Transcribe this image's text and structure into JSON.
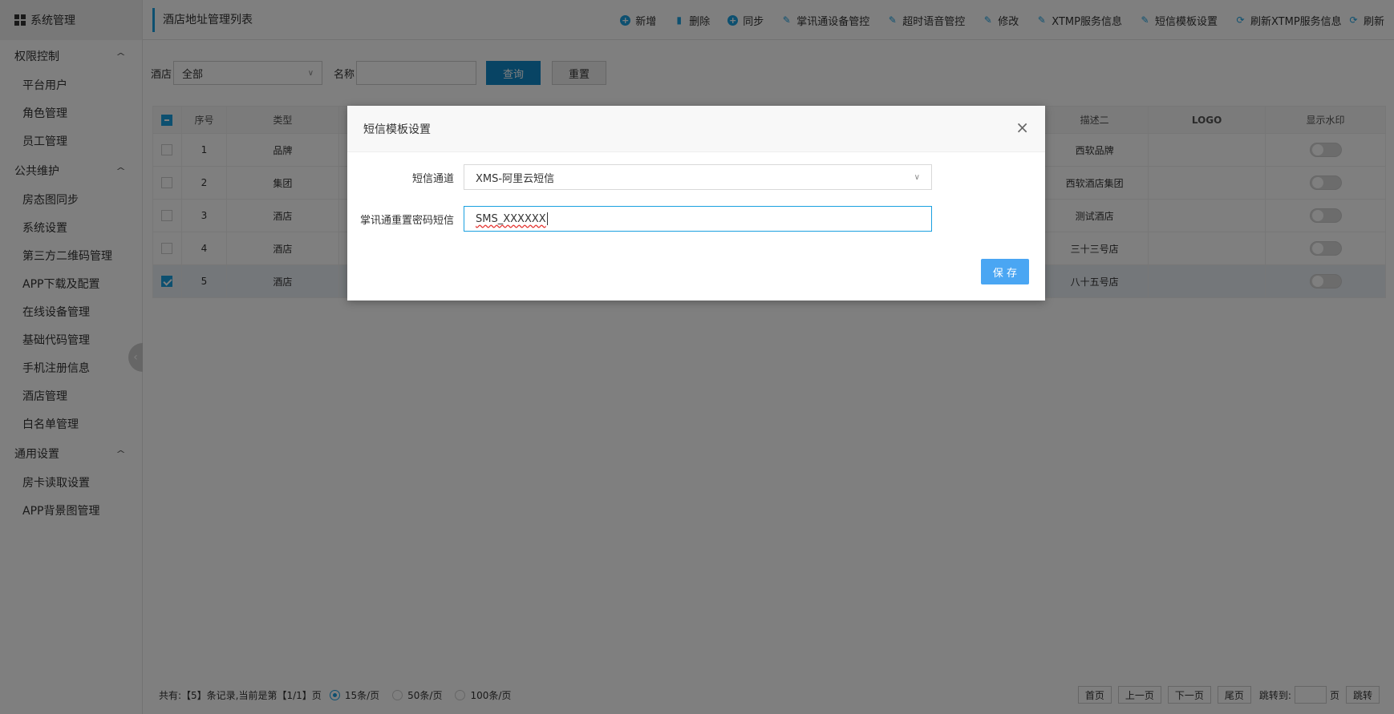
{
  "sidebar": {
    "header": "系统管理",
    "groups": [
      {
        "label": "权限控制",
        "items": [
          "平台用户",
          "角色管理",
          "员工管理"
        ]
      },
      {
        "label": "公共维护",
        "items": [
          "房态图同步",
          "系统设置",
          "第三方二维码管理",
          "APP下载及配置",
          "在线设备管理",
          "基础代码管理",
          "手机注册信息",
          "酒店管理",
          "白名单管理"
        ]
      },
      {
        "label": "通用设置",
        "items": [
          "房卡读取设置",
          "APP背景图管理"
        ]
      }
    ]
  },
  "topbar": {
    "title": "酒店地址管理列表",
    "buttons": [
      "新增",
      "删除",
      "同步",
      "掌讯通设备管控",
      "超时语音管控",
      "修改",
      "XTMP服务信息",
      "短信模板设置",
      "刷新XTMP服务信息",
      "刷新"
    ]
  },
  "search": {
    "hotel_label": "酒店",
    "hotel_value": "全部",
    "name_label": "名称",
    "query_label": "查询",
    "reset_label": "重置"
  },
  "table": {
    "headers": [
      "序号",
      "类型",
      "描述二",
      "LOGO",
      "显示水印"
    ],
    "rows": [
      {
        "no": "1",
        "type": "品牌",
        "desc2": "西软品牌",
        "checked": false
      },
      {
        "no": "2",
        "type": "集团",
        "desc2": "西软酒店集团",
        "checked": false
      },
      {
        "no": "3",
        "type": "酒店",
        "desc2": "测试酒店",
        "checked": false
      },
      {
        "no": "4",
        "type": "酒店",
        "desc2": "三十三号店",
        "checked": false
      },
      {
        "no": "5",
        "type": "酒店",
        "desc2": "八十五号店",
        "checked": true
      }
    ]
  },
  "pager": {
    "info": "共有:【5】条记录,当前是第【1/1】页",
    "sizes": [
      "15条/页",
      "50条/页",
      "100条/页"
    ],
    "buttons": [
      "首页",
      "上一页",
      "下一页",
      "尾页"
    ],
    "jump_label": "跳转到:",
    "page_suffix": "页",
    "jump_button": "跳转"
  },
  "modal": {
    "title": "短信模板设置",
    "close": "×",
    "channel_label": "短信通道",
    "channel_value": "XMS-阿里云短信",
    "reset_sms_label": "掌讯通重置密码短信",
    "reset_sms_value": "SMS_XXXXXX",
    "save_label": "保 存"
  }
}
